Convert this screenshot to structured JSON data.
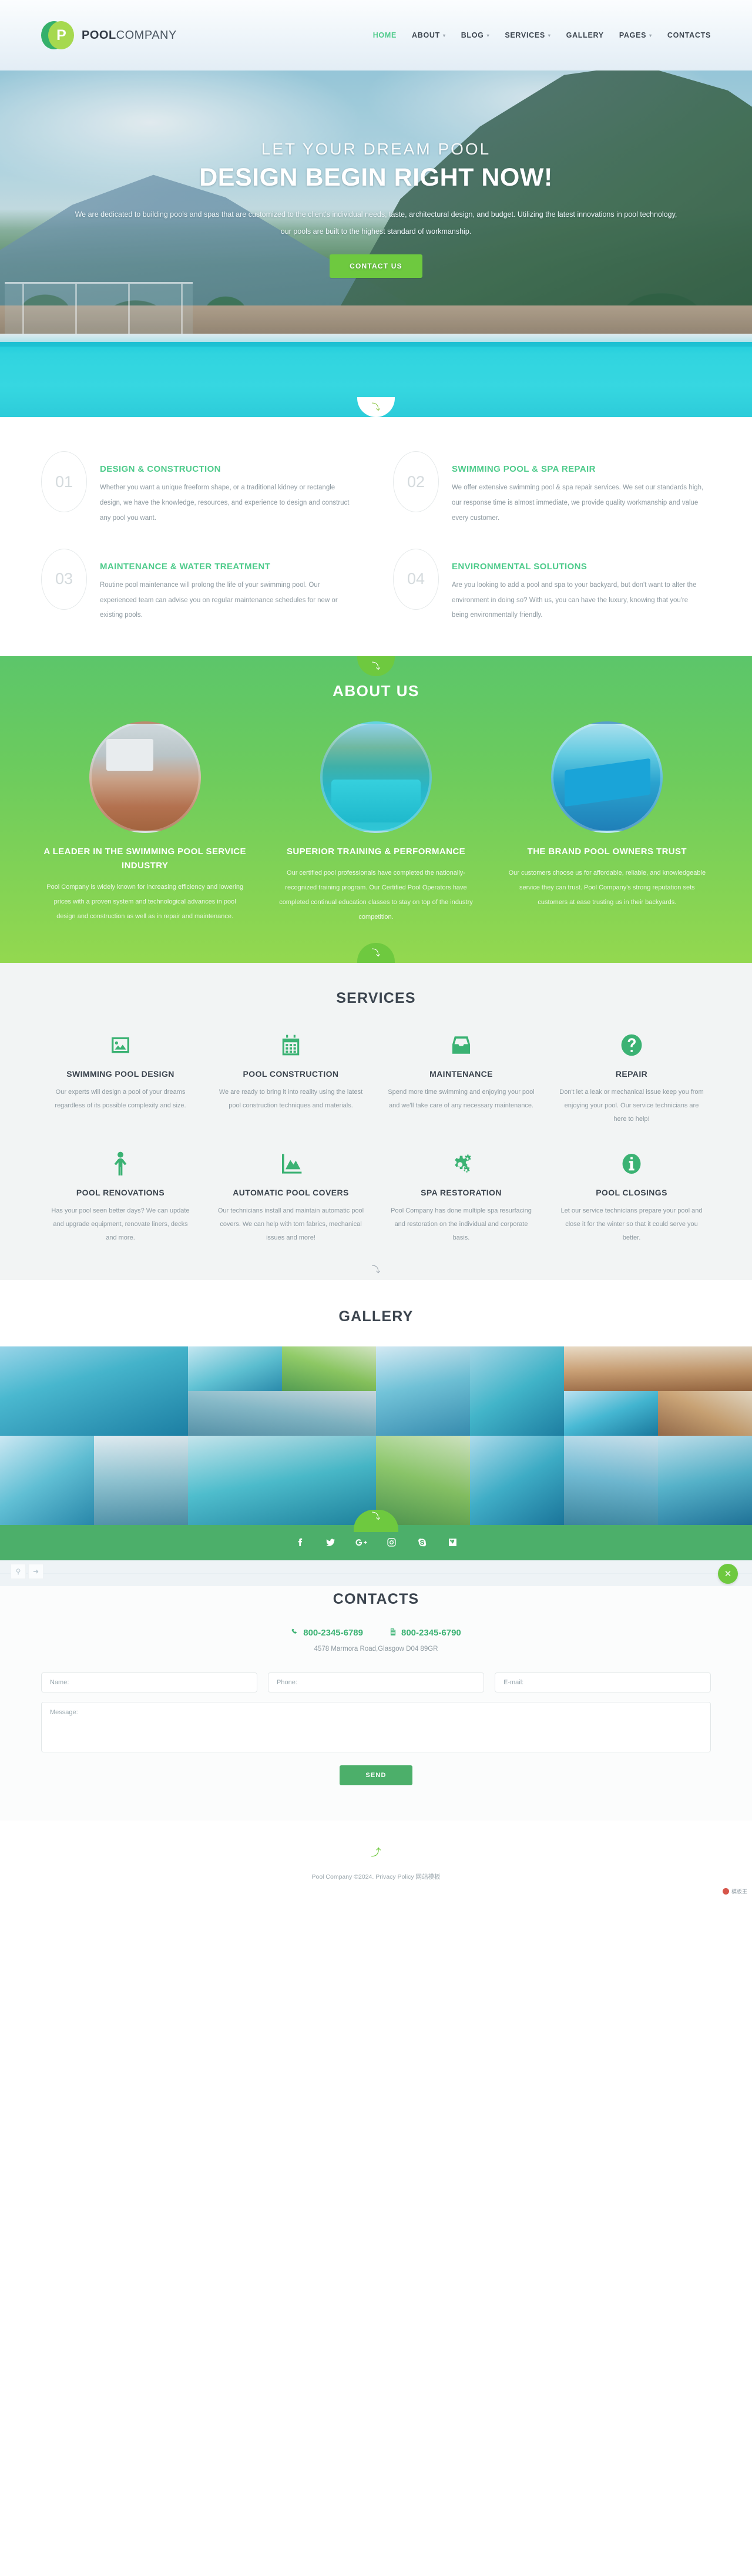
{
  "brand": {
    "logo_letter": "P",
    "name_bold": "POOL",
    "name_light": "COMPANY"
  },
  "nav": {
    "items": [
      {
        "label": "HOME",
        "active": true,
        "caret": false
      },
      {
        "label": "ABOUT",
        "active": false,
        "caret": true
      },
      {
        "label": "BLOG",
        "active": false,
        "caret": true
      },
      {
        "label": "SERVICES",
        "active": false,
        "caret": true
      },
      {
        "label": "GALLERY",
        "active": false,
        "caret": false
      },
      {
        "label": "PAGES",
        "active": false,
        "caret": true
      },
      {
        "label": "CONTACTS",
        "active": false,
        "caret": false
      }
    ]
  },
  "hero": {
    "subtitle": "LET YOUR DREAM POOL",
    "title": "DESIGN BEGIN RIGHT NOW!",
    "text": "We are dedicated to building pools and spas that are customized to the client's individual needs, taste, architectural design, and budget. Utilizing the latest innovations in pool technology, our pools are built to the highest standard of workmanship.",
    "cta": "CONTACT US"
  },
  "features": {
    "items": [
      {
        "number": "01",
        "title": "DESIGN & CONSTRUCTION",
        "desc": "Whether you want a unique freeform shape, or a traditional kidney or rectangle design, we have the knowledge, resources, and experience to design and construct any pool you want."
      },
      {
        "number": "02",
        "title": "SWIMMING POOL & SPA REPAIR",
        "desc": "We offer extensive swimming pool & spa repair services. We set our standards high, our response time is almost immediate, we provide quality workmanship and value every customer."
      },
      {
        "number": "03",
        "title": "MAINTENANCE & WATER TREATMENT",
        "desc": "Routine pool maintenance will prolong the life of your swimming pool. Our experienced team can advise you on regular maintenance schedules for new or existing pools."
      },
      {
        "number": "04",
        "title": "ENVIRONMENTAL SOLUTIONS",
        "desc": "Are you looking to add a pool and spa to your backyard, but don't want to alter the environment in doing so? With us, you can have the luxury, knowing that you're being environmentally friendly."
      }
    ]
  },
  "about": {
    "heading": "ABOUT US",
    "cards": [
      {
        "title": "A LEADER IN THE SWIMMING POOL SERVICE INDUSTRY",
        "desc": "Pool Company is widely known for increasing efficiency and lowering prices with a proven system and technological advances in pool design and construction as well as in repair and maintenance."
      },
      {
        "title": "SUPERIOR TRAINING & PERFORMANCE",
        "desc": "Our certified pool professionals have completed the nationally-recognized training program. Our Certified Pool Operators have completed continual education classes to stay on top of the industry competition."
      },
      {
        "title": "THE BRAND POOL OWNERS TRUST",
        "desc": "Our customers choose us for affordable, reliable, and knowledgeable service they can trust. Pool Company's strong reputation sets customers at ease trusting us in their backyards."
      }
    ]
  },
  "services": {
    "heading": "SERVICES",
    "items": [
      {
        "icon": "image-icon",
        "title": "SWIMMING POOL DESIGN",
        "desc": "Our experts will design a pool of your dreams regardless of its possible complexity and size."
      },
      {
        "icon": "calendar-icon",
        "title": "POOL CONSTRUCTION",
        "desc": "We are ready to bring it into reality using the latest pool construction techniques and materials."
      },
      {
        "icon": "inbox-icon",
        "title": "MAINTENANCE",
        "desc": "Spend more time swimming and enjoying your pool and we'll take care of any necessary maintenance."
      },
      {
        "icon": "question-icon",
        "title": "REPAIR",
        "desc": "Don't let a leak or mechanical issue keep you from enjoying your pool. Our service technicians are here to help!"
      },
      {
        "icon": "person-icon",
        "title": "POOL RENOVATIONS",
        "desc": "Has your pool seen better days? We can update and upgrade equipment, renovate liners, decks and more."
      },
      {
        "icon": "chart-icon",
        "title": "AUTOMATIC POOL COVERS",
        "desc": "Our technicians install and maintain automatic pool covers. We can help with torn fabrics, mechanical issues and more!"
      },
      {
        "icon": "gears-icon",
        "title": "SPA RESTORATION",
        "desc": "Pool Company has done multiple spa resurfacing and restoration on the individual and corporate basis."
      },
      {
        "icon": "info-icon",
        "title": "POOL CLOSINGS",
        "desc": "Let our service technicians prepare your pool and close it for the winter so that it could serve you better."
      }
    ]
  },
  "gallery": {
    "heading": "GALLERY",
    "tiles": [
      {
        "name": "gallery-image-1",
        "colors": [
          "#7fc6de",
          "#2fb3c9",
          "#1d7fa8"
        ]
      },
      {
        "name": "gallery-image-2",
        "colors": [
          "#a8d6e8",
          "#49b7c9",
          "#2e8fae"
        ]
      },
      {
        "name": "gallery-image-3",
        "colors": [
          "#bfe4ef",
          "#55c6d6",
          "#2d9cc0"
        ]
      },
      {
        "name": "gallery-image-4",
        "colors": [
          "#d9e9c8",
          "#8cc85f",
          "#4d9a4a"
        ]
      },
      {
        "name": "gallery-image-5",
        "colors": [
          "#cfe7f2",
          "#6cc3da",
          "#3a93b8"
        ]
      },
      {
        "name": "gallery-image-6",
        "colors": [
          "#9cd2e4",
          "#3bb6cc",
          "#1f85ab"
        ]
      },
      {
        "name": "gallery-image-7",
        "colors": [
          "#e6d7c0",
          "#c79a6c",
          "#9c6a42"
        ]
      },
      {
        "name": "gallery-image-8",
        "colors": [
          "#cfe0e6",
          "#7fb6c6",
          "#4b8ba3"
        ]
      },
      {
        "name": "gallery-image-9",
        "colors": [
          "#b5dff0",
          "#3fb9d6",
          "#1b7fa6"
        ]
      },
      {
        "name": "gallery-image-10",
        "colors": [
          "#e8dcc6",
          "#c9a06f",
          "#8e6240"
        ]
      },
      {
        "name": "gallery-image-11",
        "colors": [
          "#c7e6f2",
          "#5cc1d8",
          "#2b8fb4"
        ]
      },
      {
        "name": "gallery-image-12",
        "colors": [
          "#dce9ef",
          "#8cc3d2",
          "#4f94ac"
        ]
      },
      {
        "name": "gallery-image-13",
        "colors": [
          "#bfe2ea",
          "#45bccd",
          "#1f88a5"
        ]
      },
      {
        "name": "gallery-image-14",
        "colors": [
          "#d2e7c3",
          "#86c563",
          "#47934a"
        ]
      },
      {
        "name": "gallery-image-15",
        "colors": [
          "#a6d8ea",
          "#38aec9",
          "#1c7ba3"
        ]
      },
      {
        "name": "gallery-image-16",
        "colors": [
          "#cde4ef",
          "#6bb9d3",
          "#36849f"
        ]
      }
    ]
  },
  "social": {
    "items": [
      {
        "name": "facebook-icon",
        "label": "Facebook"
      },
      {
        "name": "twitter-icon",
        "label": "Twitter"
      },
      {
        "name": "googleplus-icon",
        "label": "Google Plus"
      },
      {
        "name": "instagram-icon",
        "label": "Instagram"
      },
      {
        "name": "skype-icon",
        "label": "Skype"
      },
      {
        "name": "vimeo-icon",
        "label": "Vimeo"
      }
    ]
  },
  "contacts": {
    "heading": "CONTACTS",
    "phone": "800-2345-6789",
    "fax": "800-2345-6790",
    "address": "4578 Marmora Road,Glasgow D04 89GR",
    "form": {
      "name_placeholder": "Name:",
      "phone_placeholder": "Phone:",
      "email_placeholder": "E-mail:",
      "message_placeholder": "Message:",
      "submit_label": "SEND"
    },
    "map_close_label": "✕"
  },
  "footer": {
    "copyright": "Pool Company ©2024.",
    "privacy_label": "Privacy Policy",
    "template_label": "网站模板",
    "badge_label": "模板王"
  }
}
